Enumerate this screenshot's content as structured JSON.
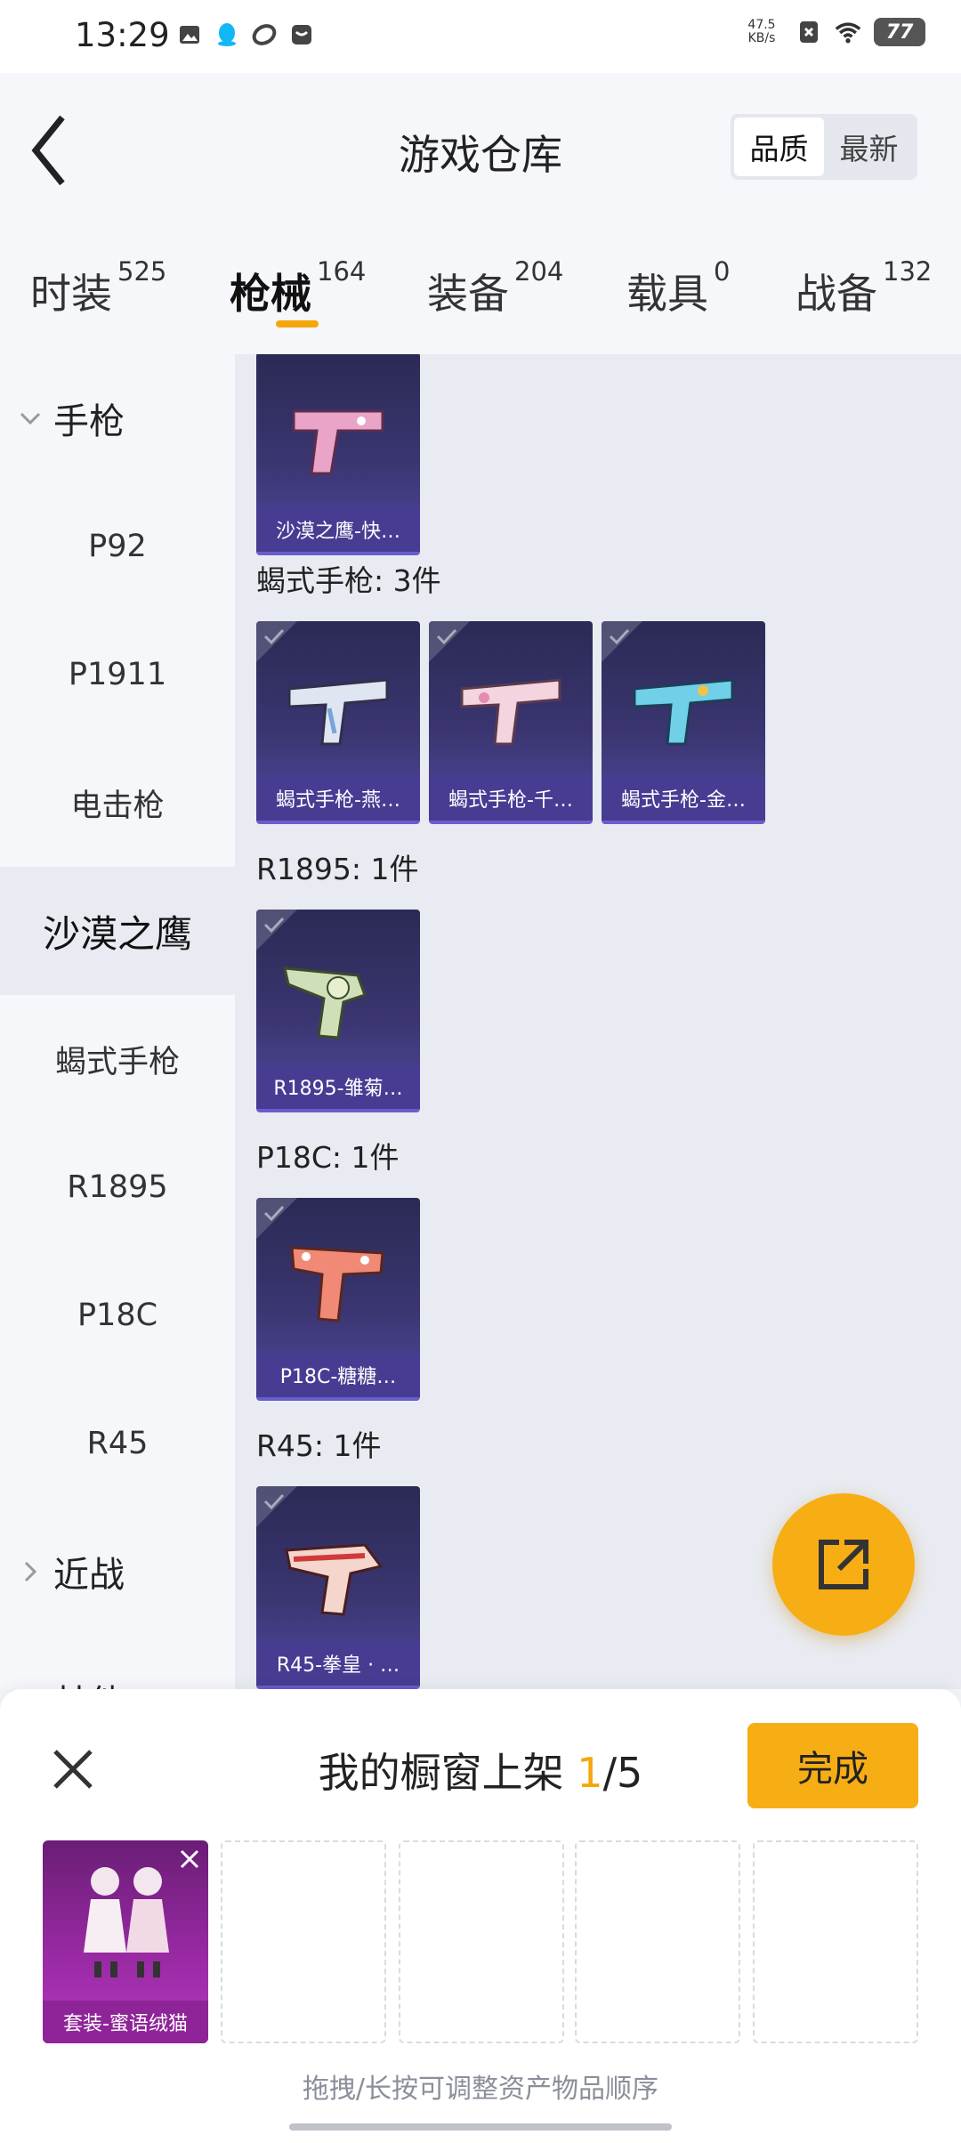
{
  "status": {
    "time": "13:29",
    "net_speed_value": "47.5",
    "net_speed_unit": "KB/s",
    "battery": "77"
  },
  "header": {
    "title": "游戏仓库",
    "sort": [
      "品质",
      "最新"
    ]
  },
  "tabs": [
    {
      "label": "时装",
      "count": "525"
    },
    {
      "label": "枪械",
      "count": "164"
    },
    {
      "label": "装备",
      "count": "204"
    },
    {
      "label": "载具",
      "count": "0"
    },
    {
      "label": "战备",
      "count": "132"
    }
  ],
  "sidebar": {
    "group_pistol": "手枪",
    "items": [
      "P92",
      "P1911",
      "电击枪",
      "沙漠之鹰",
      "蝎式手枪",
      "R1895",
      "P18C",
      "R45"
    ],
    "group_melee": "近战",
    "group_other": "其他"
  },
  "content": {
    "top_card": "沙漠之鹰-快…",
    "groups": [
      {
        "title": "蝎式手枪: 3件",
        "cards": [
          "蝎式手枪-燕…",
          "蝎式手枪-千…",
          "蝎式手枪-金…"
        ]
      },
      {
        "title": "R1895: 1件",
        "cards": [
          "R1895-雏菊…"
        ]
      },
      {
        "title": "P18C: 1件",
        "cards": [
          "P18C-糖糖…"
        ]
      },
      {
        "title": "R45: 1件",
        "cards": [
          "R45-拳皇 · …"
        ]
      }
    ]
  },
  "sheet": {
    "title_prefix": "我的橱窗上架 ",
    "current": "1",
    "total": "/5",
    "done": "完成",
    "slot_label": "套装-蜜语绒猫",
    "hint": "拖拽/长按可调整资产物品顺序"
  },
  "colors": {
    "accent": "#f7ad14",
    "card_bg": "#3a3570",
    "slot_bg": "#9b2aa5"
  }
}
